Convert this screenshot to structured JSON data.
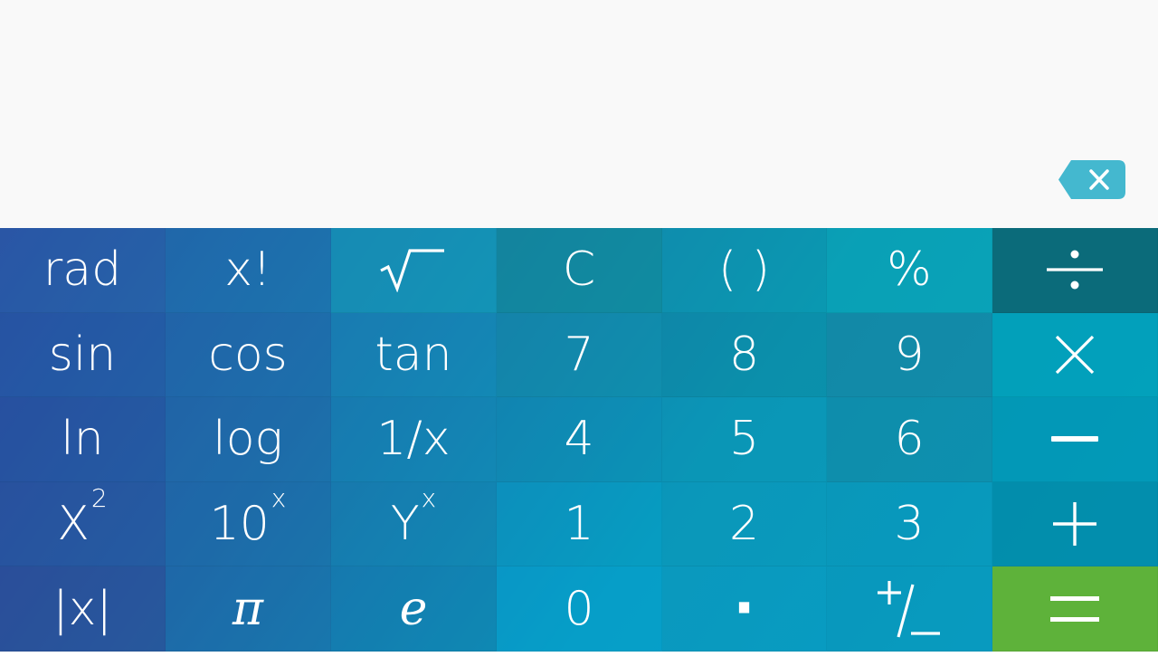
{
  "colors": {
    "display_bg": "#f9f9f9",
    "backspace_bg": "#44b8cf",
    "equals_bg": "#5eb23a",
    "divide_bg": "#0b6b7a",
    "key_text": "#ffffff"
  },
  "display": {
    "backspace_icon": "backspace-icon"
  },
  "keys": [
    {
      "id": "rad",
      "label": "rad",
      "type": "text",
      "bg": "rgba(40,110,175,0.35)"
    },
    {
      "id": "factorial",
      "label": "x!",
      "type": "text",
      "bg": "rgba(20,140,185,0.30)"
    },
    {
      "id": "sqrt",
      "label": "√‾",
      "type": "icon",
      "icon": "square-root-icon",
      "bg": "rgba(15,170,190,0.55)"
    },
    {
      "id": "clear",
      "label": "C",
      "type": "text",
      "bg": "rgba(15,140,150,0.65)"
    },
    {
      "id": "paren",
      "label": "( )",
      "type": "text",
      "bg": "rgba(10,150,170,0.50)"
    },
    {
      "id": "percent",
      "label": "%",
      "type": "text",
      "bg": "rgba(10,165,180,0.55)"
    },
    {
      "id": "divide",
      "label": "÷",
      "type": "icon",
      "icon": "divide-icon",
      "bg": "#0b6b7a"
    },
    {
      "id": "sin",
      "label": "sin",
      "type": "text",
      "bg": "rgba(35,90,165,0.40)"
    },
    {
      "id": "cos",
      "label": "cos",
      "type": "text",
      "bg": "rgba(25,115,175,0.30)"
    },
    {
      "id": "tan",
      "label": "tan",
      "type": "text",
      "bg": "rgba(15,150,190,0.40)"
    },
    {
      "id": "seven",
      "label": "7",
      "type": "text",
      "bg": "rgba(15,140,165,0.50)"
    },
    {
      "id": "eight",
      "label": "8",
      "type": "text",
      "bg": "rgba(12,130,155,0.45)"
    },
    {
      "id": "nine",
      "label": "9",
      "type": "text",
      "bg": "rgba(25,120,150,0.50)"
    },
    {
      "id": "multiply",
      "label": "×",
      "type": "icon",
      "icon": "multiply-icon",
      "bg": "rgba(0,160,185,0.75)"
    },
    {
      "id": "ln",
      "label": "ln",
      "type": "text",
      "bg": "rgba(40,75,155,0.40)"
    },
    {
      "id": "log",
      "label": "log",
      "type": "text",
      "bg": "rgba(30,105,170,0.30)"
    },
    {
      "id": "reciprocal",
      "label": "1/x",
      "type": "text",
      "bg": "rgba(15,140,185,0.35)"
    },
    {
      "id": "four",
      "label": "4",
      "type": "text",
      "bg": "rgba(10,140,180,0.35)"
    },
    {
      "id": "five",
      "label": "5",
      "type": "text",
      "bg": "rgba(10,145,180,0.40)"
    },
    {
      "id": "six",
      "label": "6",
      "type": "text",
      "bg": "rgba(20,125,155,0.45)"
    },
    {
      "id": "minus",
      "label": "−",
      "type": "icon",
      "icon": "minus-icon",
      "bg": "rgba(0,150,180,0.75)"
    },
    {
      "id": "square",
      "label": "X",
      "sup": "2",
      "type": "sup",
      "bg": "rgba(45,70,150,0.40)"
    },
    {
      "id": "ten-power",
      "label": "10",
      "sup": "x",
      "type": "sup",
      "bg": "rgba(30,100,165,0.30)"
    },
    {
      "id": "y-power",
      "label": "Y",
      "sup": "x",
      "type": "sup",
      "bg": "rgba(15,130,180,0.30)"
    },
    {
      "id": "one",
      "label": "1",
      "type": "text",
      "bg": "rgba(0,160,210,0.35)"
    },
    {
      "id": "two",
      "label": "2",
      "type": "text",
      "bg": "rgba(10,145,190,0.35)"
    },
    {
      "id": "three",
      "label": "3",
      "type": "text",
      "bg": "rgba(10,140,185,0.35)"
    },
    {
      "id": "plus",
      "label": "+",
      "type": "icon",
      "icon": "plus-icon",
      "bg": "rgba(0,135,165,0.75)"
    },
    {
      "id": "abs",
      "label": "|x|",
      "type": "text",
      "bg": "rgba(50,60,140,0.45)"
    },
    {
      "id": "pi",
      "label": "π",
      "type": "italic",
      "bg": "rgba(30,95,165,0.30)"
    },
    {
      "id": "euler",
      "label": "e",
      "type": "italic",
      "bg": "rgba(15,115,175,0.30)"
    },
    {
      "id": "zero",
      "label": "0",
      "type": "text",
      "bg": "rgba(0,165,220,0.45)"
    },
    {
      "id": "decimal",
      "label": "·",
      "type": "text",
      "bg": "rgba(10,150,200,0.35)"
    },
    {
      "id": "plus-minus",
      "label": "+/−",
      "type": "icon",
      "icon": "plus-minus-icon",
      "bg": "rgba(10,140,190,0.35)"
    },
    {
      "id": "equals",
      "label": "=",
      "type": "icon",
      "icon": "equals-icon",
      "bg": "#5eb23a"
    }
  ]
}
